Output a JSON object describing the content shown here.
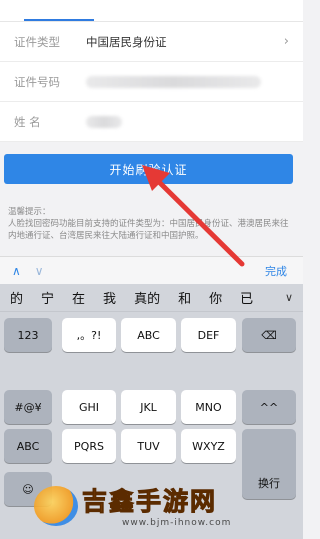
{
  "form": {
    "rows": [
      {
        "label": "证件类型",
        "value": "中国居民身份证"
      },
      {
        "label": "证件号码",
        "value": ""
      },
      {
        "label": "姓    名",
        "value": ""
      }
    ],
    "chevron": "›"
  },
  "button": {
    "label": "开始刷验认证"
  },
  "tips": {
    "title": "温馨提示：",
    "body": "人脸找回密码功能目前支持的证件类型为：中国居民身份证、港澳居民来往内地通行证、台湾居民来往大陆通行证和中国护照。"
  },
  "accessory": {
    "up": "∧",
    "down": "∨",
    "done": "完成"
  },
  "candidates": [
    "的",
    "宁",
    "在",
    "我",
    "真的",
    "和",
    "你",
    "已"
  ],
  "candidate_expand": "∨",
  "keyboard": {
    "keys": [
      {
        "label": "123"
      },
      {
        "label": ",。?!"
      },
      {
        "label": "ABC"
      },
      {
        "label": "DEF"
      },
      {
        "label": "⌫"
      },
      {
        "label": "#@¥"
      },
      {
        "label": "GHI"
      },
      {
        "label": "JKL"
      },
      {
        "label": "MNO"
      },
      {
        "label": "^^"
      },
      {
        "label": "ABC"
      },
      {
        "label": "PQRS"
      },
      {
        "label": "TUV"
      },
      {
        "label": "WXYZ"
      },
      {
        "label": "换行"
      },
      {
        "label": "☺"
      }
    ]
  },
  "watermark": {
    "text": "吉鑫手游网",
    "url": "www.bjm-ihnow.com"
  },
  "colors": {
    "accent": "#2f86e6",
    "arrow": "#e53935"
  }
}
